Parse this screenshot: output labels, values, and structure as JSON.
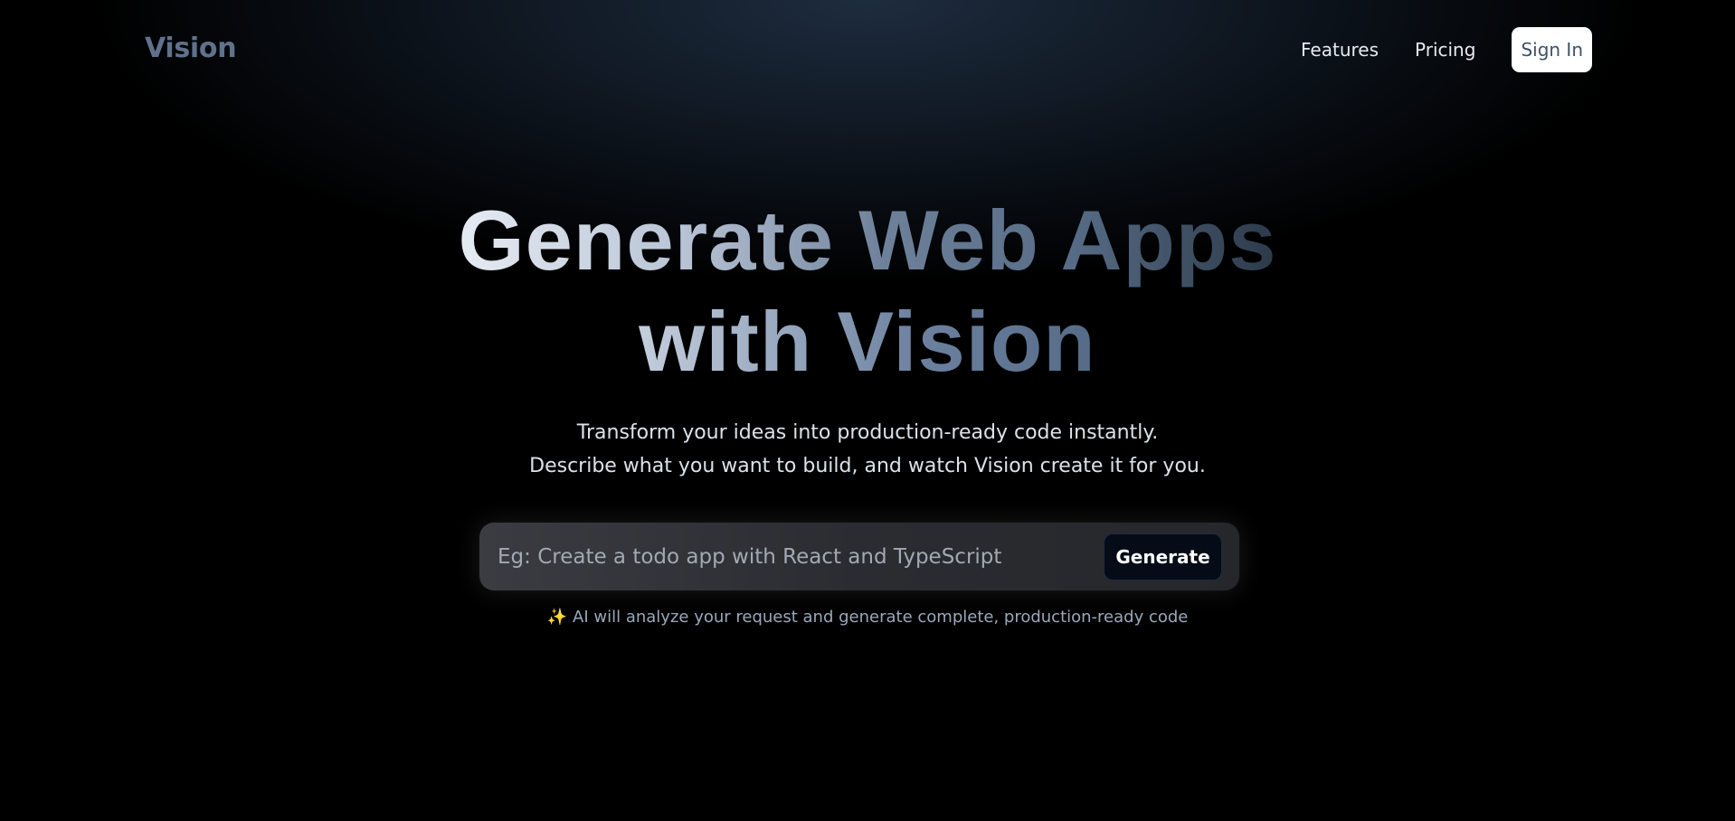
{
  "nav": {
    "logo": "Vision",
    "links": [
      "Features",
      "Pricing"
    ],
    "signin_label": "Sign In"
  },
  "hero": {
    "title_line1": "Generate Web Apps",
    "title_line2": "with Vision",
    "subtitle_line1": "Transform your ideas into production-ready code instantly.",
    "subtitle_line2": "Describe what you want to build, and watch Vision create it for you."
  },
  "prompt": {
    "placeholder": "Eg: Create a todo app with React and TypeScript",
    "value": "",
    "button_label": "Generate"
  },
  "hint": {
    "icon": "sparkles-icon",
    "text": "AI will analyze your request and generate complete, production-ready code"
  },
  "colors": {
    "background": "#000000",
    "logo": "#5f728c",
    "nav_text": "#e6ebf2",
    "signin_bg": "#ffffff",
    "signin_text": "#3f5167",
    "button_bg": "#050b17",
    "hint_text": "#9aa8bb",
    "sparkle": "#f5b24a"
  }
}
